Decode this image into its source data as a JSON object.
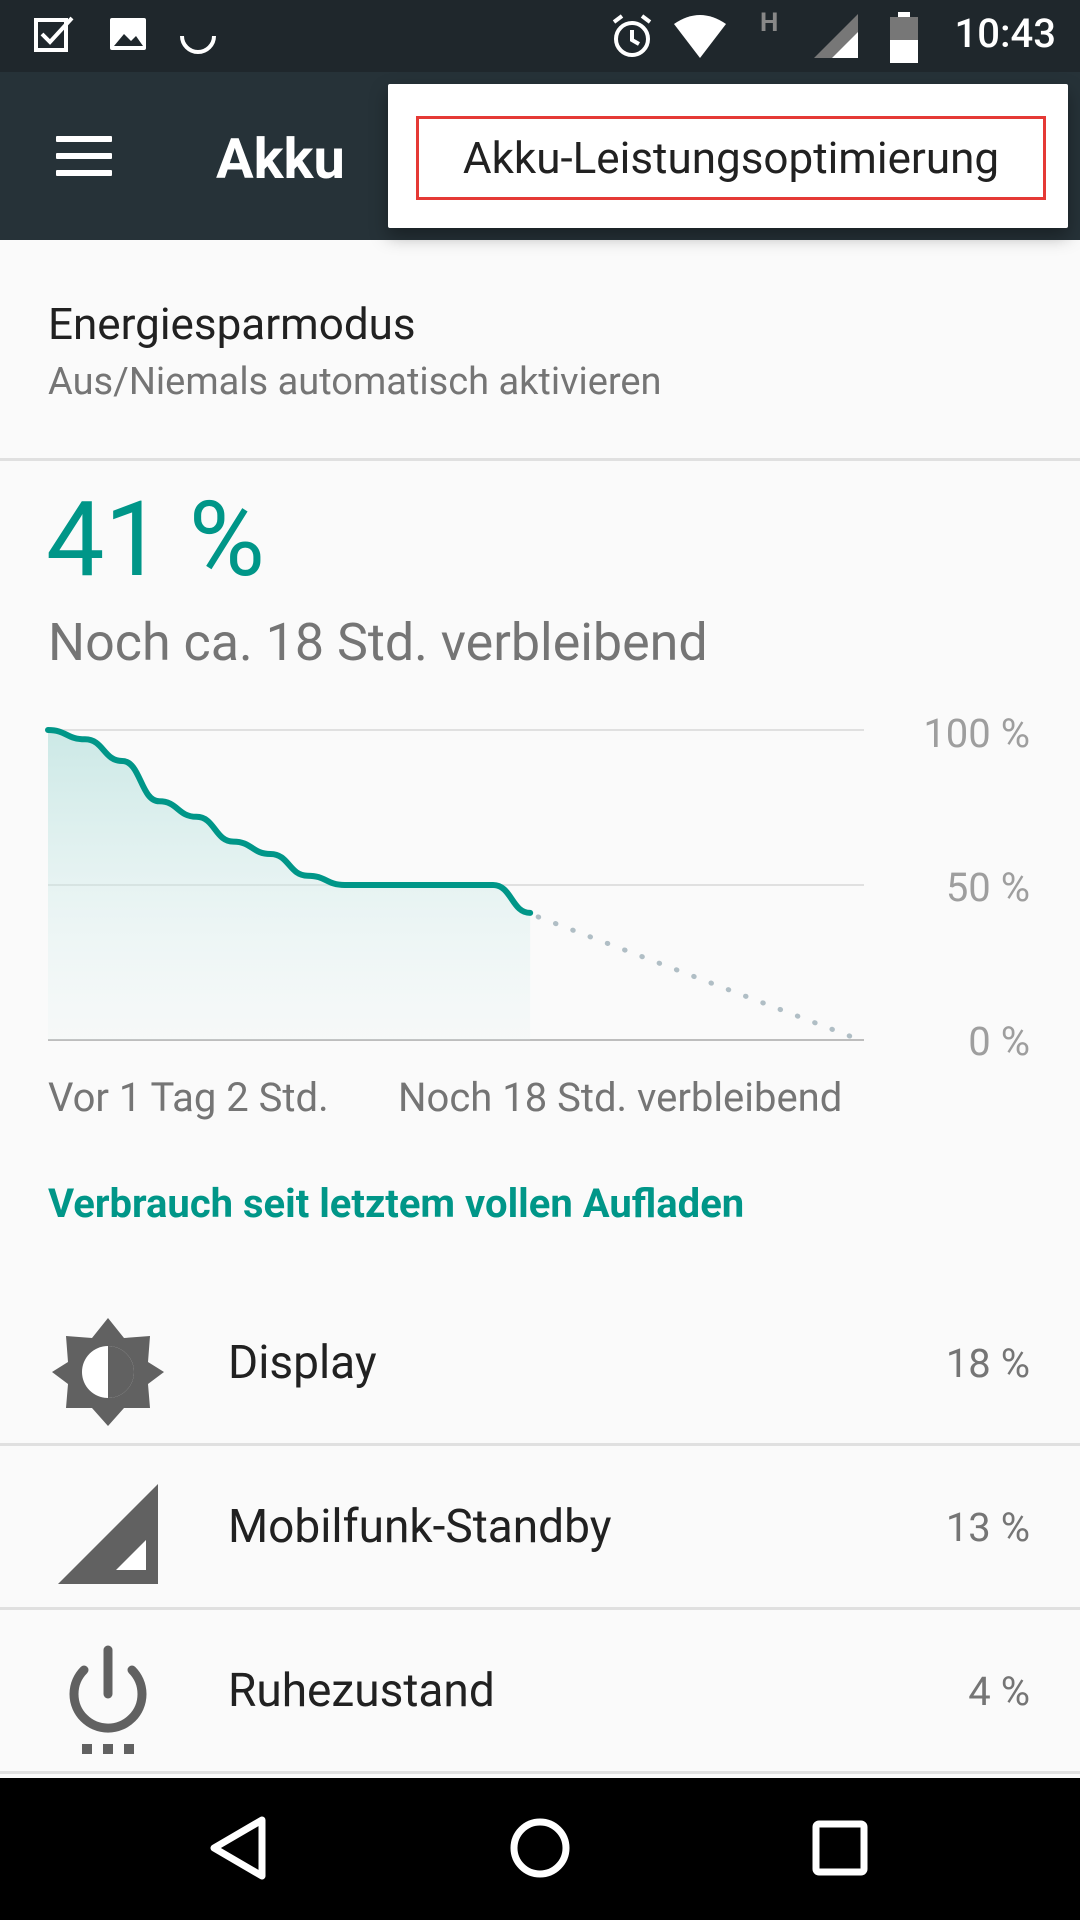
{
  "status_bar": {
    "time": "10:43",
    "battery_level_text": "41",
    "network_type": "H",
    "left_icons": [
      "task-done-icon",
      "image-icon",
      "spinner-icon"
    ],
    "right_icons": [
      "alarm-icon",
      "wifi-icon",
      "signal-icon",
      "battery-icon"
    ]
  },
  "app_bar": {
    "title": "Akku",
    "menu_icon": "hamburger-menu-icon"
  },
  "overflow_menu": {
    "items": [
      {
        "label": "Akku-Leistungsoptimierung",
        "highlight_color": "#e53935"
      }
    ]
  },
  "battery_saver": {
    "title": "Energiesparmodus",
    "subtitle": "Aus/Niemals automatisch aktivieren"
  },
  "battery": {
    "percent_text": "41 %",
    "remaining_text": "Noch ca. 18 Std. verbleibend"
  },
  "chart_data": {
    "type": "line",
    "y_ticks": [
      "100 %",
      "50 %",
      "0 %"
    ],
    "ylim": [
      0,
      100
    ],
    "x_start_label": "Vor 1 Tag 2 Std.",
    "x_end_label": "Noch 18 Std. verbleibend",
    "series": [
      {
        "x": [
          0,
          2,
          4,
          6,
          8,
          10,
          12,
          14,
          16,
          18,
          20,
          22,
          24,
          26
        ],
        "values": [
          100,
          97,
          90,
          77,
          72,
          64,
          60,
          53,
          50,
          50,
          50,
          50,
          50,
          41
        ]
      }
    ],
    "projection": {
      "x": [
        26,
        44
      ],
      "values": [
        41,
        0
      ],
      "style": "dotted"
    },
    "line_color": "#009688",
    "fill_color": "#b2dfdb",
    "projection_color": "#b0bec5"
  },
  "usage": {
    "header": "Verbrauch seit letztem vollen Aufladen",
    "items": [
      {
        "label": "Display",
        "value": "18 %",
        "icon": "brightness-icon"
      },
      {
        "label": "Mobilfunk-Standby",
        "value": "13 %",
        "icon": "cell-signal-icon"
      },
      {
        "label": "Ruhezustand",
        "value": "4 %",
        "icon": "idle-power-icon"
      }
    ]
  },
  "nav_bar": {
    "back": "back-icon",
    "home": "home-icon",
    "recents": "recents-icon"
  },
  "colors": {
    "accent": "#009688",
    "app_bar": "#263238",
    "status_bar": "#1f272c"
  }
}
